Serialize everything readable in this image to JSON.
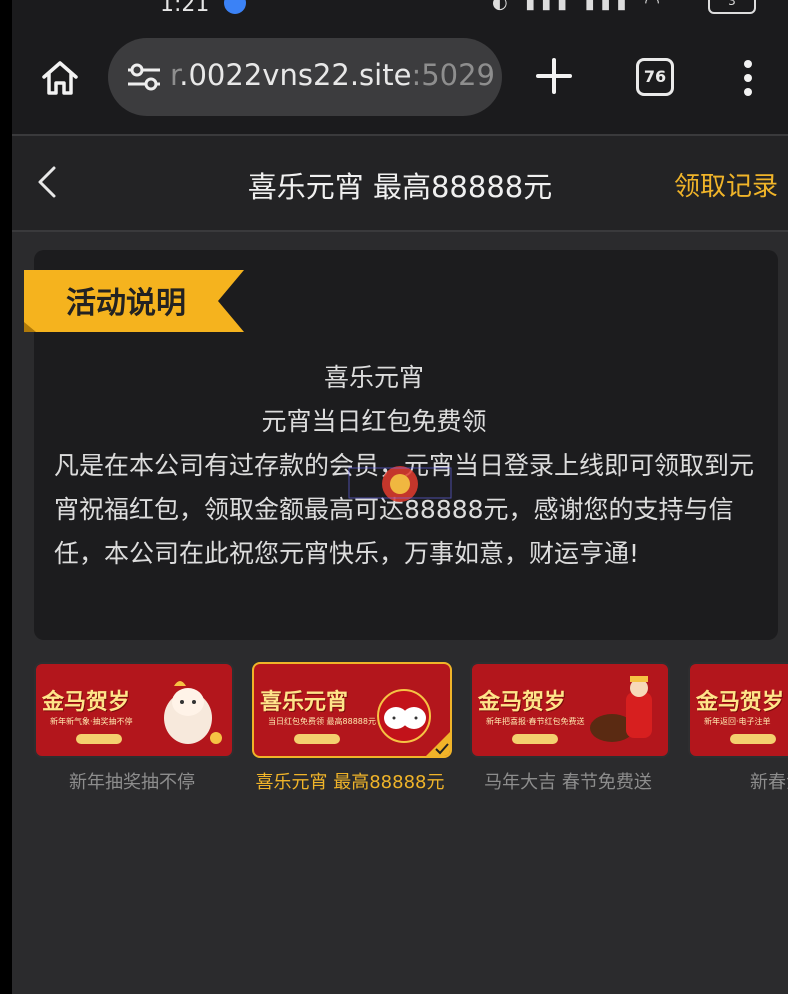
{
  "status_bar": {
    "time": "1:21",
    "battery": "3"
  },
  "browser": {
    "url_dim": "r",
    "url_main": ".0022vns22.site",
    "url_port": ":5029",
    "tab_count": "76"
  },
  "header": {
    "title": "喜乐元宵 最高88888元",
    "records_label": "领取记录"
  },
  "activity": {
    "ribbon_label": "活动说明",
    "heading_1": "喜乐元宵",
    "heading_2": "元宵当日红包免费领",
    "paragraph": "凡是在本公司有过存款的会员，元宵当日登录上线即可领取到元宵祝福红包，领取金额最高可达88888元，感谢您的支持与信任，本公司在此祝您元宵快乐，万事如意，财运亨通!"
  },
  "promotions": [
    {
      "banner_title": "金马贺岁",
      "banner_sub": "新年新气象·抽奖抽不停",
      "caption": "新年抽奖抽不停",
      "active": false
    },
    {
      "banner_title": "喜乐元宵",
      "banner_sub": "当日红包免费领 最高88888元",
      "caption": "喜乐元宵 最高88888元",
      "active": true
    },
    {
      "banner_title": "金马贺岁",
      "banner_sub": "新年把喜报·春节红包免费送",
      "caption": "马年大吉 春节免费送",
      "active": false
    },
    {
      "banner_title": "金马贺岁",
      "banner_sub": "新年返回·电子注单",
      "caption": "新春注单",
      "active": false
    }
  ],
  "colors": {
    "accent": "#f0b429",
    "banner_red": "#b3161c"
  }
}
